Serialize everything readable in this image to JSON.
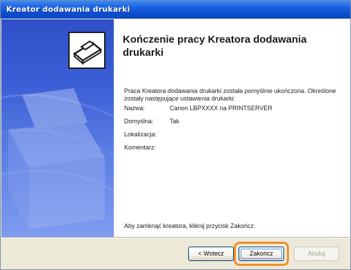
{
  "window": {
    "title": "Kreator dodawania drukarki"
  },
  "content": {
    "heading": "Kończenie pracy Kreatora dodawania drukarki",
    "intro": "Praca Kreatora dodawania drukarki została pomyślnie ukończona. Określone zostały następujące ustawienia drukarki:",
    "settings": [
      {
        "label": "Nazwa:",
        "value": "Canon LBPXXXX na PRINTSERVER"
      },
      {
        "label": "Domyślna:",
        "value": "Tak"
      },
      {
        "label": "Lokalizacja:",
        "value": ""
      },
      {
        "label": "Komentarz:",
        "value": ""
      }
    ],
    "footer": "Aby zamknąć kreatora, kliknij przycisk Zakończ."
  },
  "buttons": {
    "back": "< Wstecz",
    "finish": "Zakończ",
    "cancel": "Anuluj"
  },
  "colors": {
    "titlebar": "#0C4FD0",
    "banner": "#3B5FD6",
    "highlight": "#F28C28",
    "dialog_bg": "#ECE9D8"
  },
  "icons": {
    "banner_icon": "printer-icon"
  }
}
